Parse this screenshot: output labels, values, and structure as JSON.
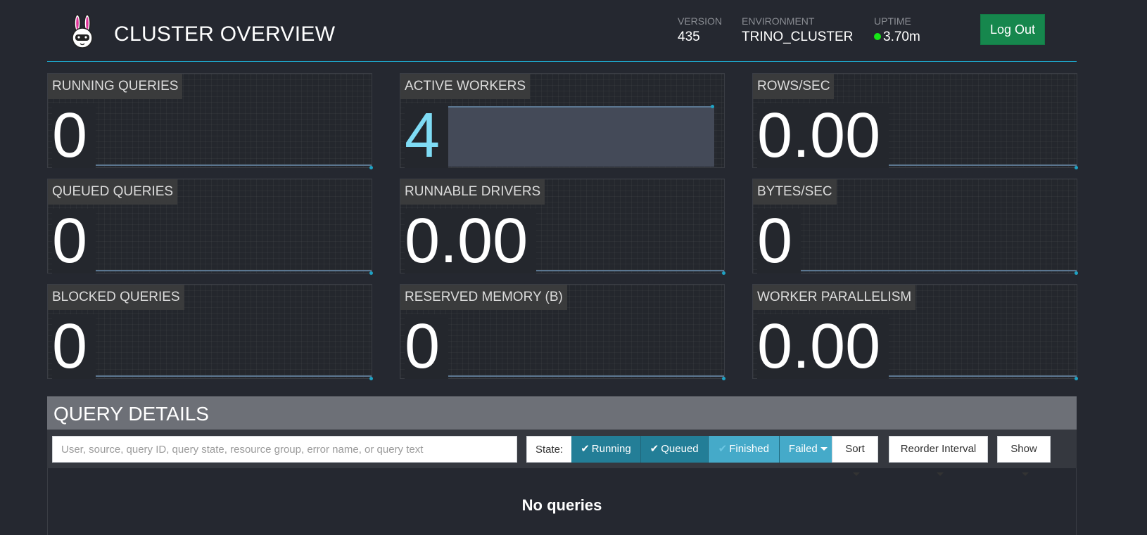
{
  "header": {
    "title": "CLUSTER OVERVIEW",
    "logo_icon": "trino-bunny-logo",
    "stats": [
      {
        "label": "VERSION",
        "value": "435"
      },
      {
        "label": "ENVIRONMENT",
        "value": "TRINO_CLUSTER"
      },
      {
        "label": "UPTIME",
        "value": "3.70m",
        "status_color": "#16e616"
      }
    ],
    "logout_label": "Log Out",
    "logout_color": "#16874d",
    "accent_color": "#1ea2c4"
  },
  "metrics": [
    {
      "label": "RUNNING QUERIES",
      "value": "0"
    },
    {
      "label": "ACTIVE WORKERS",
      "value": "4"
    },
    {
      "label": "ROWS/SEC",
      "value": "0.00"
    },
    {
      "label": "QUEUED QUERIES",
      "value": "0"
    },
    {
      "label": "RUNNABLE DRIVERS",
      "value": "0.00"
    },
    {
      "label": "BYTES/SEC",
      "value": "0"
    },
    {
      "label": "BLOCKED QUERIES",
      "value": "0"
    },
    {
      "label": "RESERVED MEMORY (B)",
      "value": "0"
    },
    {
      "label": "WORKER PARALLELISM",
      "value": "0.00"
    }
  ],
  "query_details": {
    "title": "QUERY DETAILS",
    "search_placeholder": "User, source, query ID, query state, resource group, error name, or query text",
    "search_value": "",
    "state_label": "State:",
    "states": [
      {
        "label": "Running",
        "checked": true
      },
      {
        "label": "Queued",
        "checked": true
      },
      {
        "label": "Finished",
        "checked": false
      },
      {
        "label": "Failed"
      }
    ],
    "sort_label": "Sort",
    "reorder_label": "Reorder Interval",
    "show_label": "Show",
    "empty_message": "No queries"
  }
}
